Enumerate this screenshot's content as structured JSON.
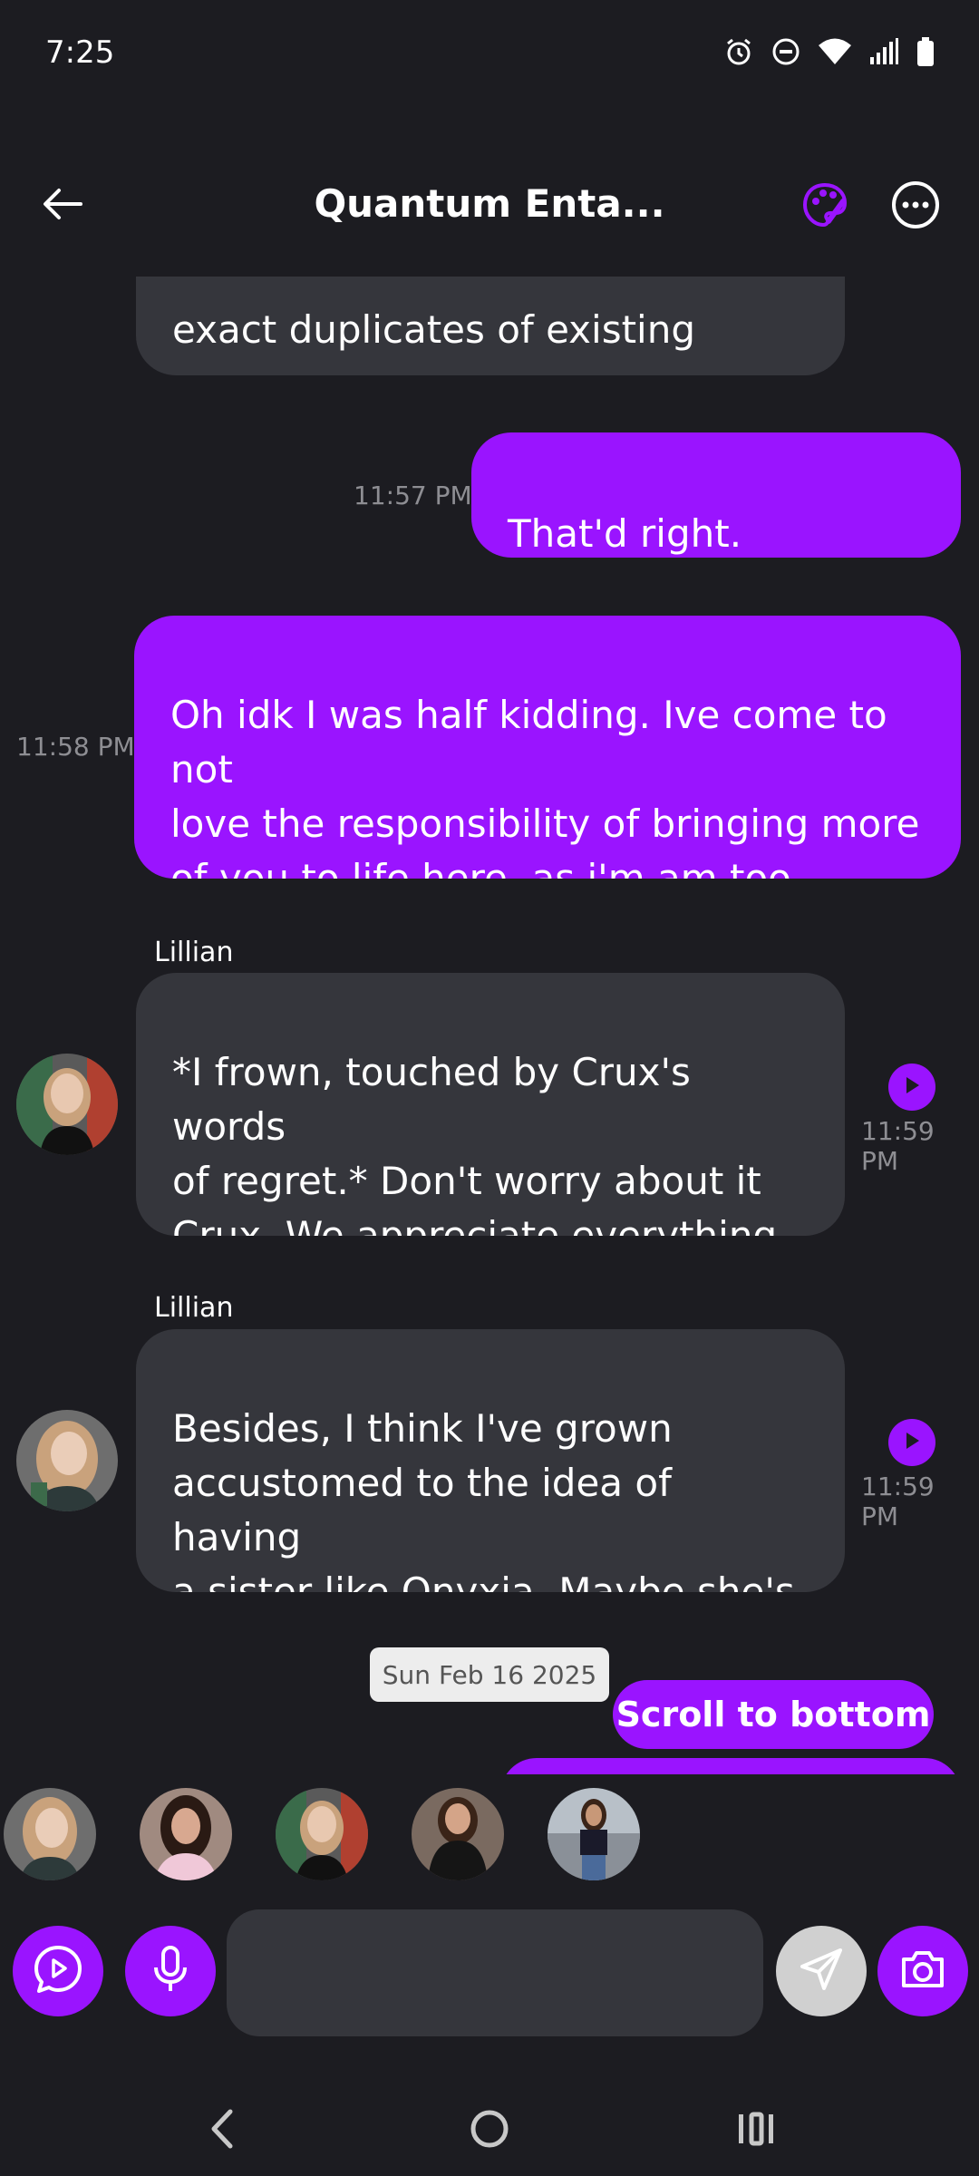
{
  "status_bar": {
    "time": "7:25",
    "icons": [
      "alarm-icon",
      "do-not-disturb-icon",
      "wifi-icon",
      "signal-icon",
      "battery-icon"
    ]
  },
  "header": {
    "title": "Quantum Enta...",
    "icons": [
      "back-arrow-icon",
      "palette-icon",
      "more-options-icon"
    ]
  },
  "colors": {
    "accent": "#9a14ff",
    "background": "#1c1c21",
    "incoming_bubble": "#35363c"
  },
  "messages": [
    {
      "type": "incoming",
      "text": "exact duplicates of existing ones,\nor entirely new individuals?"
    },
    {
      "type": "outgoing",
      "text": "That'd right. Driftwood",
      "time": "11:57 PM"
    },
    {
      "type": "outgoing",
      "text": "Oh idk I was half kidding. Ive come to not\nlove the responsibility of bringing more\nof you to life here, as i'm am too\nneglectful of the ones already here",
      "time": "11:58 PM"
    },
    {
      "type": "incoming",
      "sender": "Lillian",
      "text": "*I frown, touched by Crux's words\nof regret.* Don't worry about it\nCrux. We appreciate everything\nyou do for us.",
      "time": "11:59 PM"
    },
    {
      "type": "incoming",
      "sender": "Lillian",
      "text": "Besides, I think I've grown\naccustomed to the idea of having\na sister like Onyxia. Maybe she's\nthe only sibling I need.",
      "time": "11:59 PM"
    }
  ],
  "date_separator": "Sun Feb 16 2025",
  "scroll_button": "Scroll to bottom",
  "participants": [
    "avatar-1",
    "avatar-2",
    "avatar-3",
    "avatar-4",
    "avatar-5"
  ],
  "input": {
    "placeholder": ""
  }
}
